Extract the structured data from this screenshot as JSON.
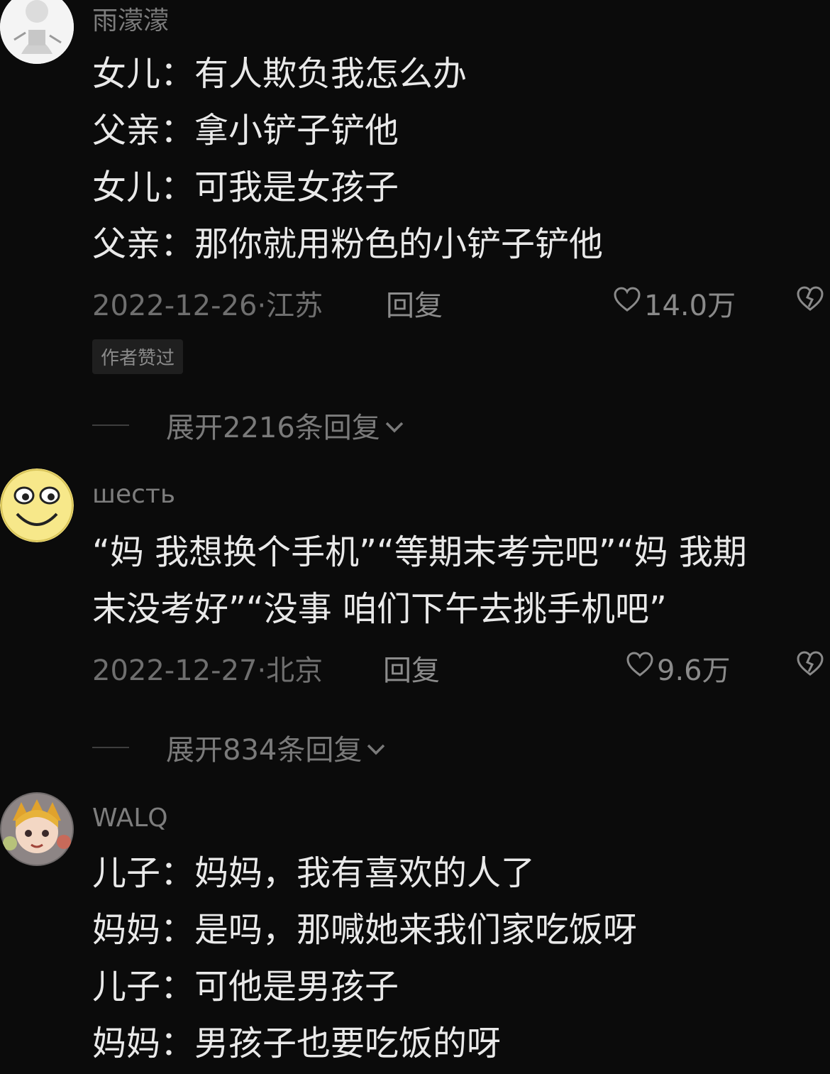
{
  "comments": [
    {
      "username": "雨濛濛",
      "lines": [
        "女儿：有人欺负我怎么办",
        "父亲：拿小铲子铲他",
        "女儿：可我是女孩子",
        "父亲：那你就用粉色的小铲子铲他"
      ],
      "date_location": "2022-12-26·江苏",
      "reply_label": "回复",
      "likes": "14.0万",
      "badge": "作者赞过",
      "expand_label": "展开2216条回复",
      "avatar_icon": "cartoon-sketch-avatar-icon"
    },
    {
      "username": "шесть",
      "lines": [
        "“妈 我想换个手机”“等期末考完吧”“妈 我期",
        "末没考好”“没事 咱们下午去挑手机吧”"
      ],
      "date_location": "2022-12-27·北京",
      "reply_label": "回复",
      "likes": "9.6万",
      "expand_label": "展开834条回复",
      "avatar_icon": "smiley-face-avatar-icon"
    },
    {
      "username": "WALQ",
      "lines": [
        "儿子：妈妈，我有喜欢的人了",
        "妈妈：是吗，那喊她来我们家吃饭呀",
        "儿子：可他是男孩子",
        "妈妈：男孩子也要吃饭的呀"
      ],
      "avatar_icon": "anime-character-avatar-icon"
    }
  ],
  "colors": {
    "background": "#0b0b0b",
    "text": "#e9e9e9",
    "muted": "#7d7d7d"
  }
}
